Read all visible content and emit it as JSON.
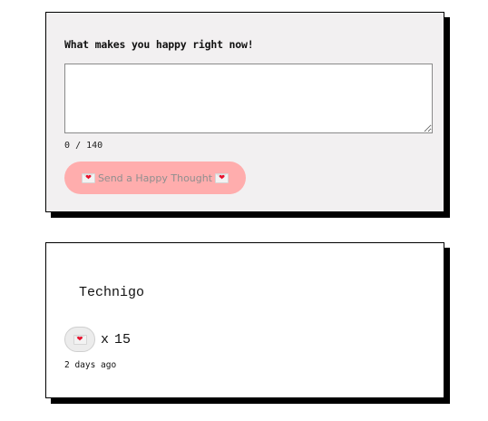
{
  "compose": {
    "prompt": "What makes you happy right now!",
    "input_value": "",
    "input_placeholder": "",
    "char_count": "0",
    "char_limit": "140",
    "char_separator": "/",
    "send_label": "Send a Happy Thought",
    "send_icon": "envelope-heart-icon",
    "send_enabled": false,
    "send_bg": "#ffadad"
  },
  "thoughts": [
    {
      "message": "Technigo",
      "like_icon": "envelope-heart-icon",
      "like_multiplier": "x",
      "likes": "15",
      "time": "2 days ago"
    }
  ]
}
